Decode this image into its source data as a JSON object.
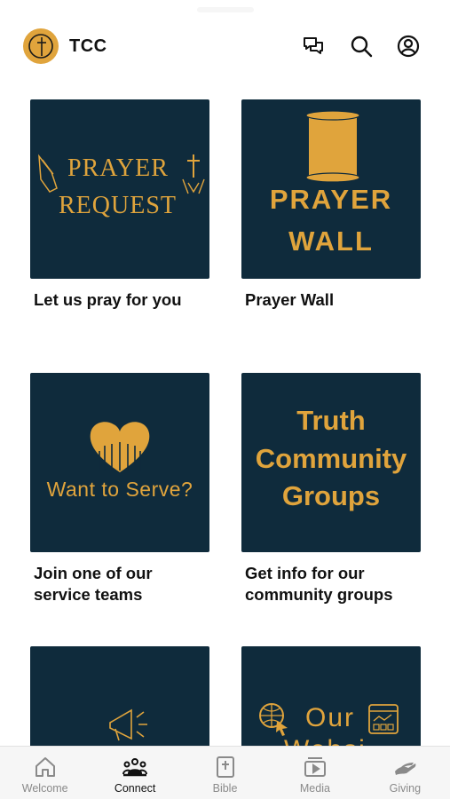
{
  "header": {
    "title": "TCC",
    "logo": "tcc-cross-logo",
    "icons": [
      "messages-icon",
      "search-icon",
      "profile-icon"
    ]
  },
  "cards": [
    {
      "label": "Let us pray for you",
      "tile_lines": [
        "PRAYER",
        "REQUEST"
      ]
    },
    {
      "label": "Prayer Wall",
      "tile_lines": [
        "PRAYER",
        "WALL"
      ]
    },
    {
      "label": "Join one of our service teams",
      "tile_lines": [
        "Want to Serve?"
      ]
    },
    {
      "label": "Get info for our community groups",
      "tile_lines": [
        "Truth",
        "Community",
        "Groups"
      ]
    },
    {
      "label": "",
      "tile_lines": []
    },
    {
      "label": "",
      "tile_lines": [
        "Our",
        "Websi"
      ]
    }
  ],
  "tabbar": {
    "active": "Connect",
    "items": [
      {
        "label": "Welcome",
        "icon": "home-icon"
      },
      {
        "label": "Connect",
        "icon": "people-icon"
      },
      {
        "label": "Bible",
        "icon": "bible-icon"
      },
      {
        "label": "Media",
        "icon": "media-icon"
      },
      {
        "label": "Giving",
        "icon": "giving-hand-icon"
      }
    ]
  },
  "colors": {
    "tile_bg": "#0f2b3c",
    "accent_gold": "#e0a43c",
    "text": "#111111",
    "tab_inactive": "#8a8a8a"
  }
}
